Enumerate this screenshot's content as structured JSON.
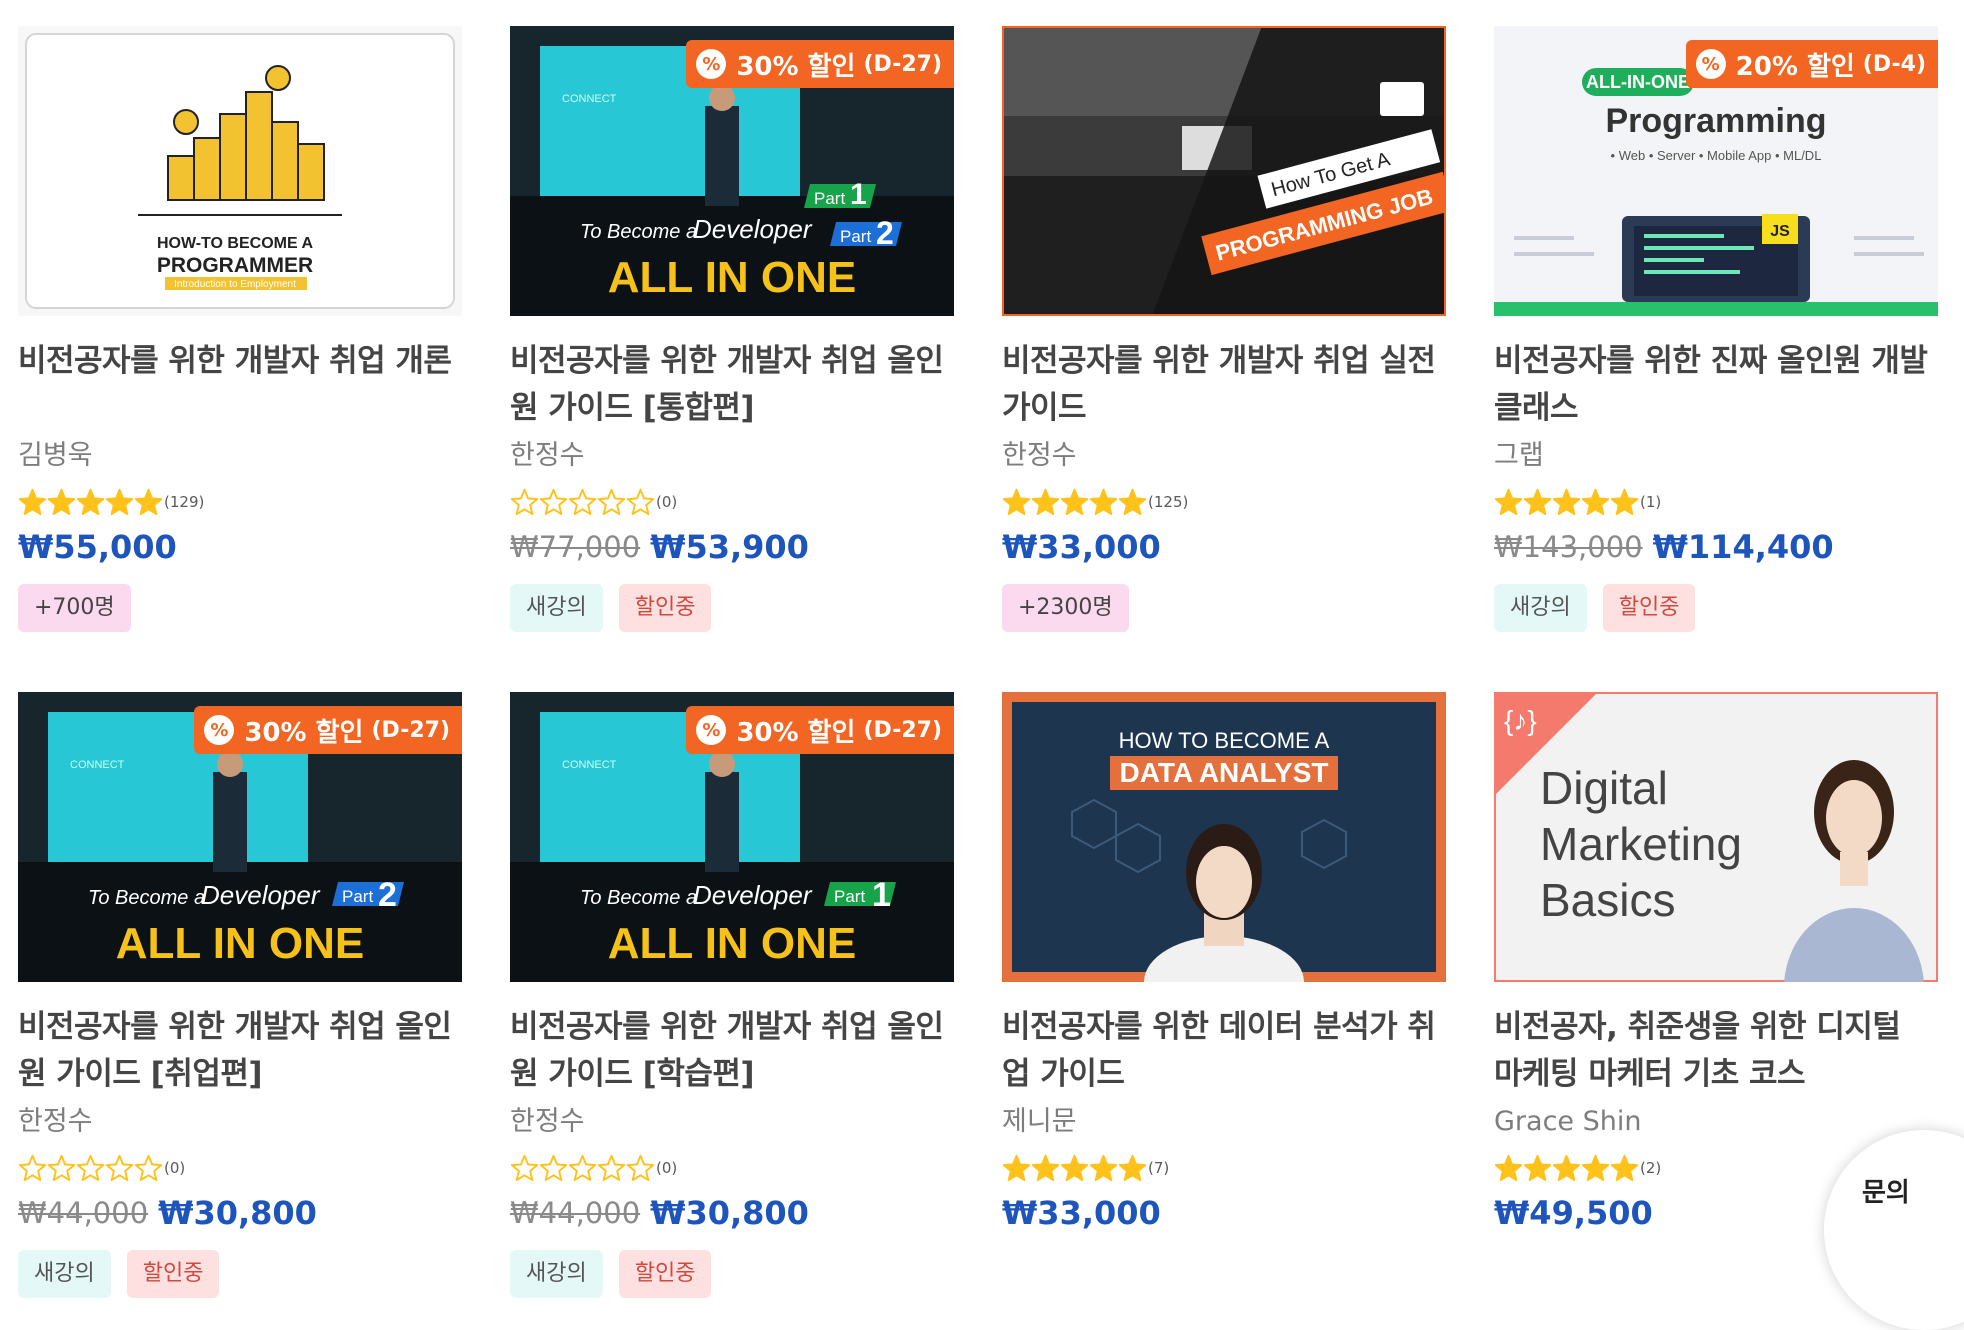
{
  "courses": [
    {
      "title": "비전공자를 위한 개발자 취업 개론",
      "instructor": "김병욱",
      "rating_count": "(129)",
      "stars_filled": 5,
      "original_price": "",
      "price": "₩55,000",
      "tags": [
        {
          "label": "+700명",
          "style": "pink"
        }
      ],
      "discount": null,
      "thumb": {
        "line1": "HOW-TO BECOME A",
        "line2": "PROGRAMMER",
        "line3": "Introduction to Employment"
      }
    },
    {
      "title": "비전공자를 위한 개발자 취업 올인원 가이드 [통합편]",
      "instructor": "한정수",
      "rating_count": "(0)",
      "stars_filled": 0,
      "original_price": "₩77,000",
      "price": "₩53,900",
      "tags": [
        {
          "label": "새강의",
          "style": "mint"
        },
        {
          "label": "할인중",
          "style": "red"
        }
      ],
      "discount": {
        "pct": "30% 할인",
        "days": "(D-27)"
      },
      "thumb": {
        "brand": "CONNECT",
        "sub": "To Become a",
        "dev": "Developer",
        "main": "ALL IN ONE",
        "part": "Part",
        "n1": "1",
        "n2": "2"
      }
    },
    {
      "title": "비전공자를 위한 개발자 취업 실전 가이드",
      "instructor": "한정수",
      "rating_count": "(125)",
      "stars_filled": 5,
      "original_price": "",
      "price": "₩33,000",
      "tags": [
        {
          "label": "+2300명",
          "style": "pink"
        }
      ],
      "discount": null,
      "thumb": {
        "line1": "How To Get A",
        "line2": "PROGRAMMING JOB"
      }
    },
    {
      "title": "비전공자를 위한 진짜 올인원 개발 클래스",
      "instructor": "그랩",
      "rating_count": "(1)",
      "stars_filled": 5,
      "original_price": "₩143,000",
      "price": "₩114,400",
      "tags": [
        {
          "label": "새강의",
          "style": "mint"
        },
        {
          "label": "할인중",
          "style": "red"
        }
      ],
      "discount": {
        "pct": "20% 할인",
        "days": "(D-4)"
      },
      "thumb": {
        "badge": "ALL-IN-ONE",
        "title": "Programming",
        "sub": "• Web  • Server  • Mobile App  • ML/DL",
        "js": "JS"
      }
    },
    {
      "title": "비전공자를 위한 개발자 취업 올인원 가이드 [취업편]",
      "instructor": "한정수",
      "rating_count": "(0)",
      "stars_filled": 0,
      "original_price": "₩44,000",
      "price": "₩30,800",
      "tags": [
        {
          "label": "새강의",
          "style": "mint"
        },
        {
          "label": "할인중",
          "style": "red"
        }
      ],
      "discount": {
        "pct": "30% 할인",
        "days": "(D-27)"
      },
      "thumb": {
        "brand": "CONNECT",
        "sub": "To Become a",
        "dev": "Developer",
        "main": "ALL IN ONE",
        "part": "Part",
        "n1": "",
        "n2": "2"
      }
    },
    {
      "title": "비전공자를 위한 개발자 취업 올인원 가이드 [학습편]",
      "instructor": "한정수",
      "rating_count": "(0)",
      "stars_filled": 0,
      "original_price": "₩44,000",
      "price": "₩30,800",
      "tags": [
        {
          "label": "새강의",
          "style": "mint"
        },
        {
          "label": "할인중",
          "style": "red"
        }
      ],
      "discount": {
        "pct": "30% 할인",
        "days": "(D-27)"
      },
      "thumb": {
        "brand": "CONNECT",
        "sub": "To Become a",
        "dev": "Developer",
        "main": "ALL IN ONE",
        "part": "Part",
        "n1": "1",
        "n2": ""
      }
    },
    {
      "title": "비전공자를 위한 데이터 분석가 취업 가이드",
      "instructor": "제니문",
      "rating_count": "(7)",
      "stars_filled": 5,
      "original_price": "",
      "price": "₩33,000",
      "tags": [],
      "discount": null,
      "thumb": {
        "line1": "HOW TO BECOME A",
        "line2": "DATA ANALYST"
      }
    },
    {
      "title": "비전공자, 취준생을 위한 디지털 마케팅 마케터 기초 코스",
      "instructor": "Grace Shin",
      "rating_count": "(2)",
      "stars_filled": 5,
      "original_price": "",
      "price": "₩49,500",
      "tags": [],
      "discount": null,
      "thumb": {
        "line1": "Digital",
        "line2": "Marketing",
        "line3": "Basics",
        "logo": "{♪}"
      }
    }
  ],
  "chat": {
    "label": "문의"
  },
  "colors": {
    "accent": "#f26522",
    "price": "#1d55bd",
    "star": "#ffc21a"
  }
}
